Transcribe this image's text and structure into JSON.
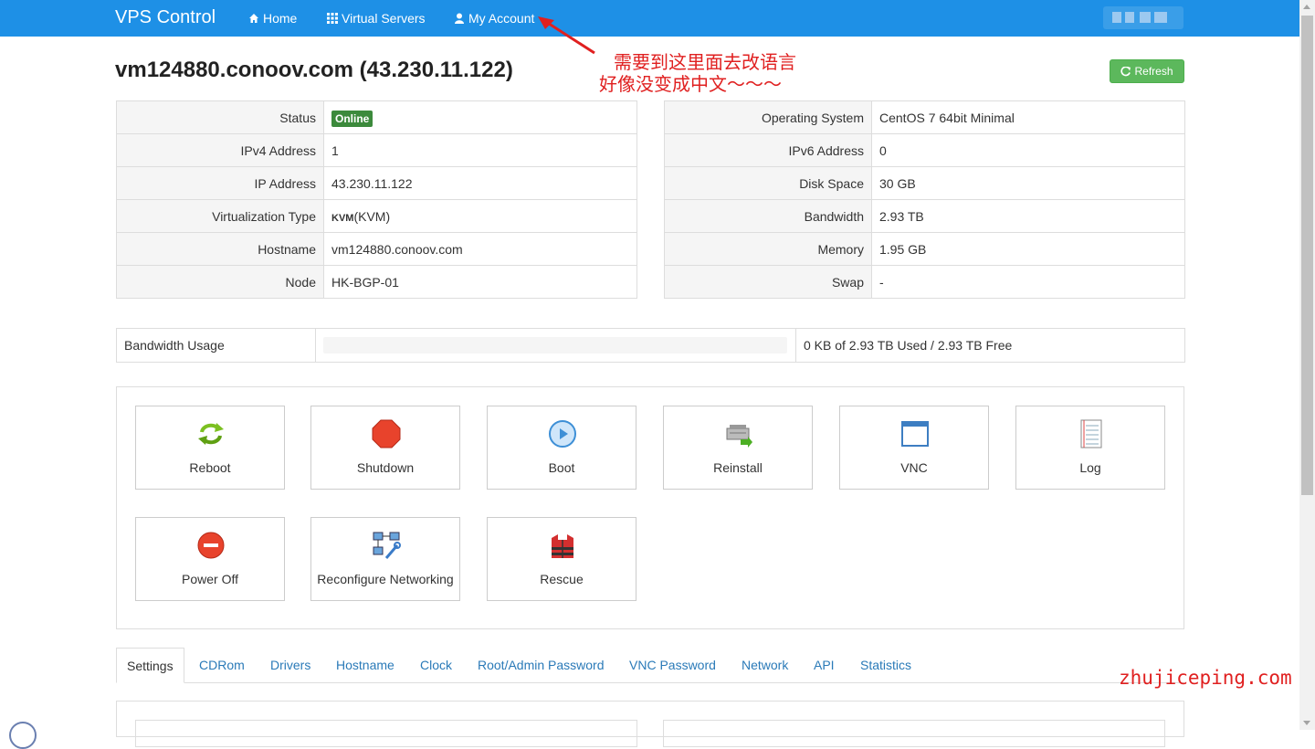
{
  "nav": {
    "brand": "VPS Control",
    "home": "Home",
    "virtual_servers": "Virtual Servers",
    "my_account": "My Account"
  },
  "page_title": "vm124880.conoov.com (43.230.11.122)",
  "annotation": {
    "line1": "需要到这里面去改语言",
    "line2": "好像没变成中文～～～"
  },
  "refresh_label": "Refresh",
  "left_info": [
    {
      "label": "Status",
      "value": "Online"
    },
    {
      "label": "IPv4 Address",
      "value": "1"
    },
    {
      "label": "IP Address",
      "value": "43.230.11.122"
    },
    {
      "label": "Virtualization Type",
      "value": "(KVM)",
      "logo": "KVM"
    },
    {
      "label": "Hostname",
      "value": "vm124880.conoov.com"
    },
    {
      "label": "Node",
      "value": "HK-BGP-01"
    }
  ],
  "right_info": [
    {
      "label": "Operating System",
      "value": "CentOS 7 64bit Minimal"
    },
    {
      "label": "IPv6 Address",
      "value": "0"
    },
    {
      "label": "Disk Space",
      "value": "30 GB"
    },
    {
      "label": "Bandwidth",
      "value": "2.93 TB"
    },
    {
      "label": "Memory",
      "value": "1.95 GB"
    },
    {
      "label": "Swap",
      "value": "-"
    }
  ],
  "bandwidth": {
    "label": "Bandwidth Usage",
    "used_fraction": 0,
    "summary": "0 KB of 2.93 TB Used / 2.93 TB Free"
  },
  "actions": [
    {
      "label": "Reboot",
      "icon": "reboot-icon"
    },
    {
      "label": "Shutdown",
      "icon": "shutdown-icon"
    },
    {
      "label": "Boot",
      "icon": "boot-icon"
    },
    {
      "label": "Reinstall",
      "icon": "reinstall-icon"
    },
    {
      "label": "VNC",
      "icon": "vnc-icon"
    },
    {
      "label": "Log",
      "icon": "log-icon"
    },
    {
      "label": "Power Off",
      "icon": "power-off-icon"
    },
    {
      "label": "Reconfigure Networking",
      "icon": "network-icon"
    },
    {
      "label": "Rescue",
      "icon": "rescue-icon"
    }
  ],
  "tabs": [
    "Settings",
    "CDRom",
    "Drivers",
    "Hostname",
    "Clock",
    "Root/Admin Password",
    "VNC Password",
    "Network",
    "API",
    "Statistics"
  ],
  "watermark": "zhujiceping.com",
  "colors": {
    "navbar": "#1e90e6",
    "accent_green": "#5cb85c",
    "annotation_red": "#e02020",
    "link_blue": "#2a7ab8"
  }
}
